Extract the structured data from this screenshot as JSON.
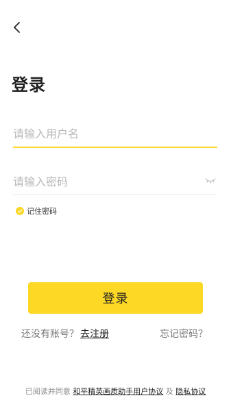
{
  "header": {
    "back_icon": "chevron-left-icon"
  },
  "title": "登录",
  "username": {
    "placeholder": "请输入用户名",
    "value": ""
  },
  "password": {
    "placeholder": "请输入密码",
    "value": "",
    "eye_icon": "eye-closed-icon"
  },
  "remember": {
    "label": "记住密码",
    "checked": true
  },
  "login_button": {
    "label": "登录"
  },
  "register": {
    "prompt": "还没有账号？",
    "link": "去注册"
  },
  "forgot": {
    "label": "忘记密码？"
  },
  "agreement": {
    "prefix": "已阅读并同意",
    "user_agreement": "和平精英画质助手用户协议",
    "and": "及",
    "privacy": "隐私协议"
  },
  "colors": {
    "accent": "#fdd825",
    "text": "#222222",
    "muted": "#888888"
  }
}
